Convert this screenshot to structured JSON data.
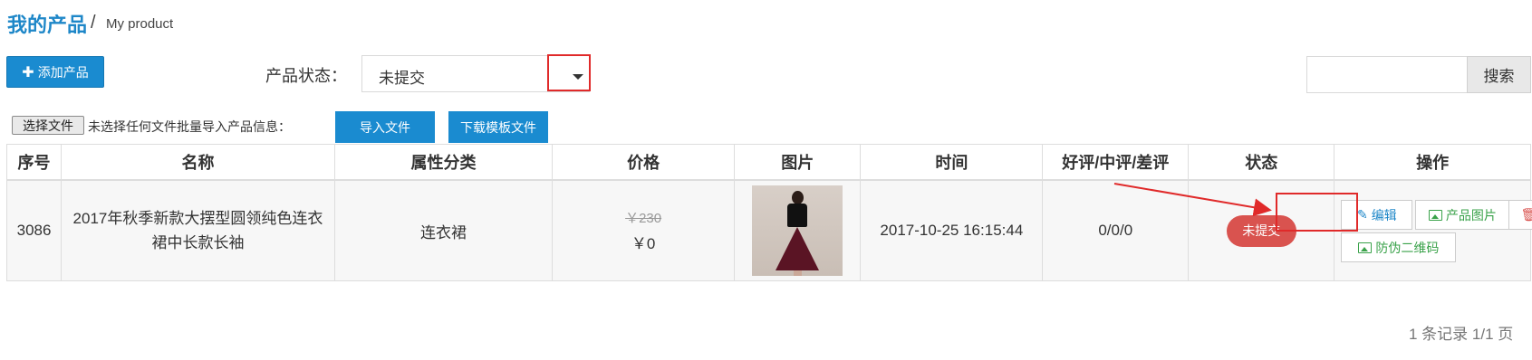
{
  "header": {
    "title_cn": "我的产品",
    "separator": "/",
    "title_en": "My product"
  },
  "toolbar": {
    "add_icon": "plus-icon",
    "add_label": "添加产品",
    "status_label": "产品状态：",
    "status_value": "未提交",
    "search_placeholder": "",
    "search_label": "搜索"
  },
  "file_import": {
    "choose_label": "选择文件",
    "note": "未选择任何文件批量导入产品信息：",
    "import_label": "导入文件",
    "template_label": "下载模板文件"
  },
  "table": {
    "columns": [
      "序号",
      "名称",
      "属性分类",
      "价格",
      "图片",
      "时间",
      "好评/中评/差评",
      "状态",
      "操作"
    ],
    "rows": [
      {
        "id": "3086",
        "name": "2017年秋季新款大摆型圆领纯色连衣裙中长款长袖",
        "category": "连衣裙",
        "old_price": "￥230",
        "price": "￥0",
        "image_desc": "product-photo-dress",
        "time": "2017-10-25 16:15:44",
        "reviews": "0/0/0",
        "status": "未提交",
        "actions": {
          "edit": "编辑",
          "photos": "产品图片",
          "delete": "删除",
          "qrcode": "防伪二维码"
        }
      }
    ]
  },
  "pager": {
    "text": "1 条记录 1/1 页"
  },
  "colors": {
    "primary": "#1a8bd0",
    "danger": "#d9534f",
    "success": "#3aa24a",
    "highlight": "#e02a2a"
  }
}
